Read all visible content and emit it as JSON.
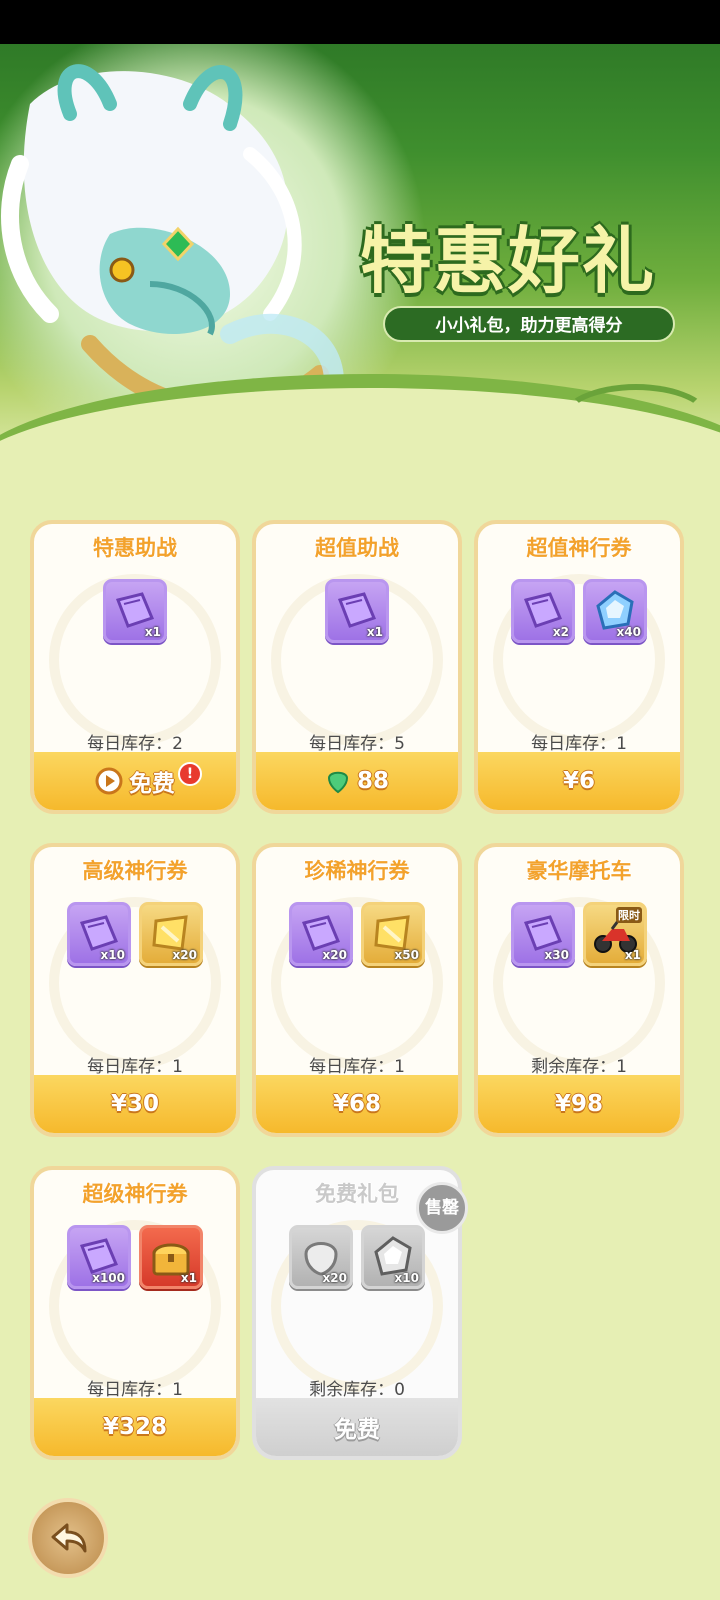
{
  "banner": {
    "title": "特惠好礼",
    "subtitle": "小小礼包，助力更高得分"
  },
  "gifts": [
    {
      "title": "特惠助战",
      "items": [
        {
          "icon": "purple-ticket-icon",
          "qty": "x1"
        }
      ],
      "stock": "每日库存：2",
      "price": "免费",
      "price_icon": "video-play-icon",
      "alert": "!"
    },
    {
      "title": "超值助战",
      "items": [
        {
          "icon": "purple-ticket-icon",
          "qty": "x1"
        }
      ],
      "stock": "每日库存：5",
      "price": "88",
      "price_icon": "green-gem-icon"
    },
    {
      "title": "超值神行券",
      "items": [
        {
          "icon": "purple-ticket-icon",
          "qty": "x2"
        },
        {
          "icon": "blue-crystal-icon",
          "qty": "x40"
        }
      ],
      "stock": "每日库存：1",
      "price": "¥6"
    },
    {
      "title": "高级神行券",
      "items": [
        {
          "icon": "purple-ticket-icon",
          "qty": "x10"
        },
        {
          "icon": "gold-ticket-icon",
          "qty": "x20"
        }
      ],
      "stock": "每日库存：1",
      "price": "¥30"
    },
    {
      "title": "珍稀神行券",
      "items": [
        {
          "icon": "purple-ticket-icon",
          "qty": "x20"
        },
        {
          "icon": "gold-ticket-icon",
          "qty": "x50"
        }
      ],
      "stock": "每日库存：1",
      "price": "¥68"
    },
    {
      "title": "豪华摩托车",
      "items": [
        {
          "icon": "purple-ticket-icon",
          "qty": "x30"
        },
        {
          "icon": "motorcycle-icon",
          "qty": "x1",
          "tag": "限时"
        }
      ],
      "stock": "剩余库存：1",
      "price": "¥98"
    },
    {
      "title": "超级神行券",
      "items": [
        {
          "icon": "purple-ticket-icon",
          "qty": "x100"
        },
        {
          "icon": "treasure-chest-icon",
          "qty": "x1"
        }
      ],
      "stock": "每日库存：1",
      "price": "¥328"
    },
    {
      "title": "免费礼包",
      "items": [
        {
          "icon": "grey-stone-icon",
          "qty": "x20"
        },
        {
          "icon": "grey-crystal-icon",
          "qty": "x10"
        }
      ],
      "stock": "剩余库存：0",
      "price": "免费",
      "sold_out_badge": "售罄"
    }
  ],
  "colors": {
    "background": "#e6efb4",
    "title_orange": "#f3a22c",
    "price_bar": "#f6b92c",
    "card_border": "#f0d79a",
    "banner_green": "#2f7a27"
  },
  "back_icon": "back-arrow-icon"
}
